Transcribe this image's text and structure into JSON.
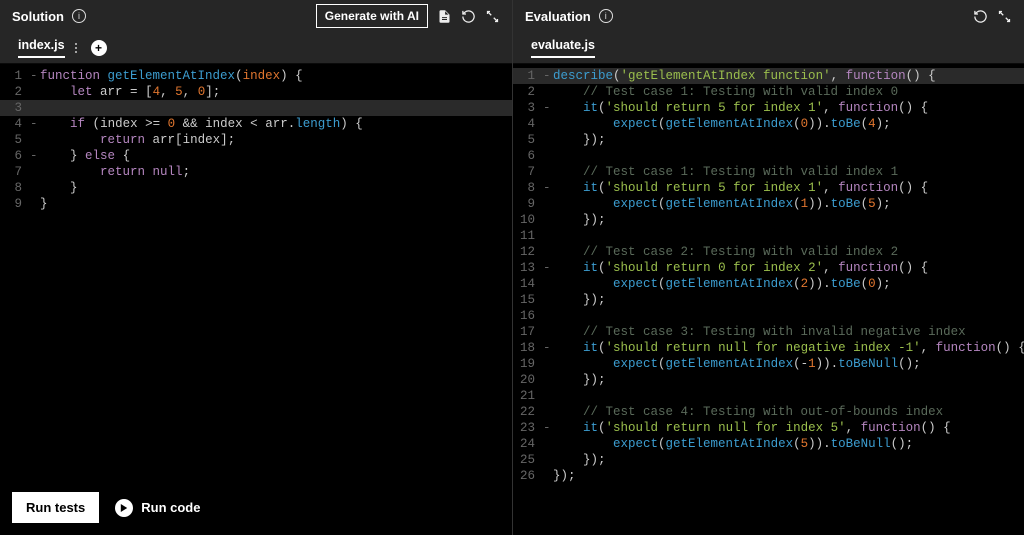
{
  "solution": {
    "title": "Solution",
    "ai_button": "Generate with AI",
    "tab": "index.js",
    "lines": [
      {
        "n": 1,
        "fold": "-",
        "tokens": [
          [
            "kw",
            "function"
          ],
          [
            "plain",
            " "
          ],
          [
            "fn",
            "getElementAtIndex"
          ],
          [
            "punc",
            "("
          ],
          [
            "var",
            "index"
          ],
          [
            "punc",
            ")"
          ],
          [
            "plain",
            " "
          ],
          [
            "punc",
            "{"
          ]
        ]
      },
      {
        "n": 2,
        "fold": "",
        "tokens": [
          [
            "plain",
            "    "
          ],
          [
            "kw",
            "let"
          ],
          [
            "plain",
            " arr "
          ],
          [
            "op",
            "="
          ],
          [
            "plain",
            " "
          ],
          [
            "punc",
            "["
          ],
          [
            "num",
            "4"
          ],
          [
            "punc",
            ","
          ],
          [
            "plain",
            " "
          ],
          [
            "num",
            "5"
          ],
          [
            "punc",
            ","
          ],
          [
            "plain",
            " "
          ],
          [
            "num",
            "0"
          ],
          [
            "punc",
            "];"
          ]
        ]
      },
      {
        "n": 3,
        "fold": "",
        "active": true,
        "tokens": []
      },
      {
        "n": 4,
        "fold": "-",
        "tokens": [
          [
            "plain",
            "    "
          ],
          [
            "kw",
            "if"
          ],
          [
            "plain",
            " "
          ],
          [
            "punc",
            "("
          ],
          [
            "plain",
            "index "
          ],
          [
            "op",
            ">="
          ],
          [
            "plain",
            " "
          ],
          [
            "num",
            "0"
          ],
          [
            "plain",
            " "
          ],
          [
            "op",
            "&&"
          ],
          [
            "plain",
            " index "
          ],
          [
            "op",
            "<"
          ],
          [
            "plain",
            " arr"
          ],
          [
            "punc",
            "."
          ],
          [
            "prop",
            "length"
          ],
          [
            "punc",
            ")"
          ],
          [
            "plain",
            " "
          ],
          [
            "punc",
            "{"
          ]
        ]
      },
      {
        "n": 5,
        "fold": "",
        "tokens": [
          [
            "plain",
            "        "
          ],
          [
            "kw",
            "return"
          ],
          [
            "plain",
            " arr"
          ],
          [
            "punc",
            "["
          ],
          [
            "plain",
            "index"
          ],
          [
            "punc",
            "];"
          ]
        ]
      },
      {
        "n": 6,
        "fold": "-",
        "tokens": [
          [
            "plain",
            "    "
          ],
          [
            "punc",
            "}"
          ],
          [
            "plain",
            " "
          ],
          [
            "kw",
            "else"
          ],
          [
            "plain",
            " "
          ],
          [
            "punc",
            "{"
          ]
        ]
      },
      {
        "n": 7,
        "fold": "",
        "tokens": [
          [
            "plain",
            "        "
          ],
          [
            "kw",
            "return"
          ],
          [
            "plain",
            " "
          ],
          [
            "kw",
            "null"
          ],
          [
            "punc",
            ";"
          ]
        ]
      },
      {
        "n": 8,
        "fold": "",
        "tokens": [
          [
            "plain",
            "    "
          ],
          [
            "punc",
            "}"
          ]
        ]
      },
      {
        "n": 9,
        "fold": "",
        "tokens": [
          [
            "punc",
            "}"
          ]
        ]
      }
    ]
  },
  "evaluation": {
    "title": "Evaluation",
    "tab": "evaluate.js",
    "lines": [
      {
        "n": 1,
        "fold": "-",
        "active": true,
        "tokens": [
          [
            "fn",
            "describe"
          ],
          [
            "punc",
            "("
          ],
          [
            "str",
            "'getElementAtIndex function'"
          ],
          [
            "punc",
            ","
          ],
          [
            "plain",
            " "
          ],
          [
            "kw",
            "function"
          ],
          [
            "punc",
            "()"
          ],
          [
            "plain",
            " "
          ],
          [
            "punc",
            "{"
          ]
        ]
      },
      {
        "n": 2,
        "fold": "",
        "tokens": [
          [
            "plain",
            "    "
          ],
          [
            "comment",
            "// Test case 1: Testing with valid index 0"
          ]
        ]
      },
      {
        "n": 3,
        "fold": "-",
        "tokens": [
          [
            "plain",
            "    "
          ],
          [
            "fn",
            "it"
          ],
          [
            "punc",
            "("
          ],
          [
            "str",
            "'should return 5 for index 1'"
          ],
          [
            "punc",
            ","
          ],
          [
            "plain",
            " "
          ],
          [
            "kw",
            "function"
          ],
          [
            "punc",
            "()"
          ],
          [
            "plain",
            " "
          ],
          [
            "punc",
            "{"
          ]
        ]
      },
      {
        "n": 4,
        "fold": "",
        "tokens": [
          [
            "plain",
            "        "
          ],
          [
            "fn",
            "expect"
          ],
          [
            "punc",
            "("
          ],
          [
            "fn",
            "getElementAtIndex"
          ],
          [
            "punc",
            "("
          ],
          [
            "num",
            "0"
          ],
          [
            "punc",
            "))."
          ],
          [
            "fn",
            "toBe"
          ],
          [
            "punc",
            "("
          ],
          [
            "num",
            "4"
          ],
          [
            "punc",
            ");"
          ]
        ]
      },
      {
        "n": 5,
        "fold": "",
        "tokens": [
          [
            "plain",
            "    "
          ],
          [
            "punc",
            "});"
          ]
        ]
      },
      {
        "n": 6,
        "fold": "",
        "tokens": []
      },
      {
        "n": 7,
        "fold": "",
        "tokens": [
          [
            "plain",
            "    "
          ],
          [
            "comment",
            "// Test case 1: Testing with valid index 1"
          ]
        ]
      },
      {
        "n": 8,
        "fold": "-",
        "tokens": [
          [
            "plain",
            "    "
          ],
          [
            "fn",
            "it"
          ],
          [
            "punc",
            "("
          ],
          [
            "str",
            "'should return 5 for index 1'"
          ],
          [
            "punc",
            ","
          ],
          [
            "plain",
            " "
          ],
          [
            "kw",
            "function"
          ],
          [
            "punc",
            "()"
          ],
          [
            "plain",
            " "
          ],
          [
            "punc",
            "{"
          ]
        ]
      },
      {
        "n": 9,
        "fold": "",
        "tokens": [
          [
            "plain",
            "        "
          ],
          [
            "fn",
            "expect"
          ],
          [
            "punc",
            "("
          ],
          [
            "fn",
            "getElementAtIndex"
          ],
          [
            "punc",
            "("
          ],
          [
            "num",
            "1"
          ],
          [
            "punc",
            "))."
          ],
          [
            "fn",
            "toBe"
          ],
          [
            "punc",
            "("
          ],
          [
            "num",
            "5"
          ],
          [
            "punc",
            ");"
          ]
        ]
      },
      {
        "n": 10,
        "fold": "",
        "tokens": [
          [
            "plain",
            "    "
          ],
          [
            "punc",
            "});"
          ]
        ]
      },
      {
        "n": 11,
        "fold": "",
        "tokens": []
      },
      {
        "n": 12,
        "fold": "",
        "tokens": [
          [
            "plain",
            "    "
          ],
          [
            "comment",
            "// Test case 2: Testing with valid index 2"
          ]
        ]
      },
      {
        "n": 13,
        "fold": "-",
        "tokens": [
          [
            "plain",
            "    "
          ],
          [
            "fn",
            "it"
          ],
          [
            "punc",
            "("
          ],
          [
            "str",
            "'should return 0 for index 2'"
          ],
          [
            "punc",
            ","
          ],
          [
            "plain",
            " "
          ],
          [
            "kw",
            "function"
          ],
          [
            "punc",
            "()"
          ],
          [
            "plain",
            " "
          ],
          [
            "punc",
            "{"
          ]
        ]
      },
      {
        "n": 14,
        "fold": "",
        "tokens": [
          [
            "plain",
            "        "
          ],
          [
            "fn",
            "expect"
          ],
          [
            "punc",
            "("
          ],
          [
            "fn",
            "getElementAtIndex"
          ],
          [
            "punc",
            "("
          ],
          [
            "num",
            "2"
          ],
          [
            "punc",
            "))."
          ],
          [
            "fn",
            "toBe"
          ],
          [
            "punc",
            "("
          ],
          [
            "num",
            "0"
          ],
          [
            "punc",
            ");"
          ]
        ]
      },
      {
        "n": 15,
        "fold": "",
        "tokens": [
          [
            "plain",
            "    "
          ],
          [
            "punc",
            "});"
          ]
        ]
      },
      {
        "n": 16,
        "fold": "",
        "tokens": []
      },
      {
        "n": 17,
        "fold": "",
        "tokens": [
          [
            "plain",
            "    "
          ],
          [
            "comment",
            "// Test case 3: Testing with invalid negative index"
          ]
        ]
      },
      {
        "n": 18,
        "fold": "-",
        "tokens": [
          [
            "plain",
            "    "
          ],
          [
            "fn",
            "it"
          ],
          [
            "punc",
            "("
          ],
          [
            "str",
            "'should return null for negative index -1'"
          ],
          [
            "punc",
            ","
          ],
          [
            "plain",
            " "
          ],
          [
            "kw",
            "function"
          ],
          [
            "punc",
            "()"
          ],
          [
            "plain",
            " "
          ],
          [
            "punc",
            "{"
          ]
        ]
      },
      {
        "n": 19,
        "fold": "",
        "tokens": [
          [
            "plain",
            "        "
          ],
          [
            "fn",
            "expect"
          ],
          [
            "punc",
            "("
          ],
          [
            "fn",
            "getElementAtIndex"
          ],
          [
            "punc",
            "("
          ],
          [
            "op",
            "-"
          ],
          [
            "num",
            "1"
          ],
          [
            "punc",
            "))."
          ],
          [
            "fn",
            "toBeNull"
          ],
          [
            "punc",
            "();"
          ]
        ]
      },
      {
        "n": 20,
        "fold": "",
        "tokens": [
          [
            "plain",
            "    "
          ],
          [
            "punc",
            "});"
          ]
        ]
      },
      {
        "n": 21,
        "fold": "",
        "tokens": []
      },
      {
        "n": 22,
        "fold": "",
        "tokens": [
          [
            "plain",
            "    "
          ],
          [
            "comment",
            "// Test case 4: Testing with out-of-bounds index"
          ]
        ]
      },
      {
        "n": 23,
        "fold": "-",
        "tokens": [
          [
            "plain",
            "    "
          ],
          [
            "fn",
            "it"
          ],
          [
            "punc",
            "("
          ],
          [
            "str",
            "'should return null for index 5'"
          ],
          [
            "punc",
            ","
          ],
          [
            "plain",
            " "
          ],
          [
            "kw",
            "function"
          ],
          [
            "punc",
            "()"
          ],
          [
            "plain",
            " "
          ],
          [
            "punc",
            "{"
          ]
        ]
      },
      {
        "n": 24,
        "fold": "",
        "tokens": [
          [
            "plain",
            "        "
          ],
          [
            "fn",
            "expect"
          ],
          [
            "punc",
            "("
          ],
          [
            "fn",
            "getElementAtIndex"
          ],
          [
            "punc",
            "("
          ],
          [
            "num",
            "5"
          ],
          [
            "punc",
            "))."
          ],
          [
            "fn",
            "toBeNull"
          ],
          [
            "punc",
            "();"
          ]
        ]
      },
      {
        "n": 25,
        "fold": "",
        "tokens": [
          [
            "plain",
            "    "
          ],
          [
            "punc",
            "});"
          ]
        ]
      },
      {
        "n": 26,
        "fold": "",
        "tokens": [
          [
            "punc",
            "});"
          ]
        ]
      }
    ]
  },
  "footer": {
    "run_tests": "Run tests",
    "run_code": "Run code"
  }
}
